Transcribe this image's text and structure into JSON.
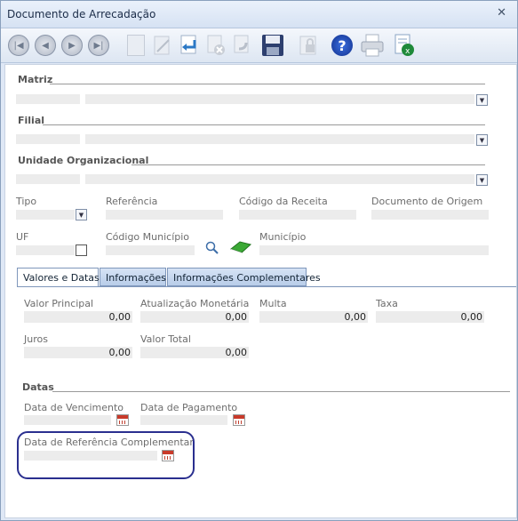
{
  "window": {
    "title": "Documento de Arrecadação",
    "close_label": "✕"
  },
  "toolbar": {
    "buttons": [
      "first-record",
      "previous-record",
      "next-record",
      "last-record",
      "new",
      "edit",
      "confirm",
      "cancel",
      "redo",
      "save",
      "lock",
      "help",
      "print",
      "export"
    ],
    "help_glyph": "?"
  },
  "sections": {
    "matriz": "Matriz",
    "filial": "Filial",
    "unidade": "Unidade Organizacional",
    "datas": "Datas"
  },
  "labels": {
    "tipo": "Tipo",
    "referencia": "Referência",
    "codigo_receita": "Código da Receita",
    "documento_origem": "Documento de Origem",
    "uf": "UF",
    "codigo_municipio": "Código Município",
    "municipio": "Município",
    "valor_principal": "Valor Principal",
    "atualizacao": "Atualização Monetária",
    "multa": "Multa",
    "taxa": "Taxa",
    "juros": "Juros",
    "valor_total": "Valor Total",
    "data_vencimento": "Data de Vencimento",
    "data_pagamento": "Data de Pagamento",
    "data_ref_complementar": "Data de Referência Complementar"
  },
  "tabs": [
    "Valores e Datas",
    "Informações",
    "Informações Complementares"
  ],
  "values": {
    "valor_principal": "0,00",
    "atualizacao": "0,00",
    "multa": "0,00",
    "taxa": "0,00",
    "juros": "0,00",
    "valor_total": "0,00"
  },
  "colors": {
    "highlight_border": "#2a2f8f",
    "calendar_red": "#c93a2a"
  }
}
